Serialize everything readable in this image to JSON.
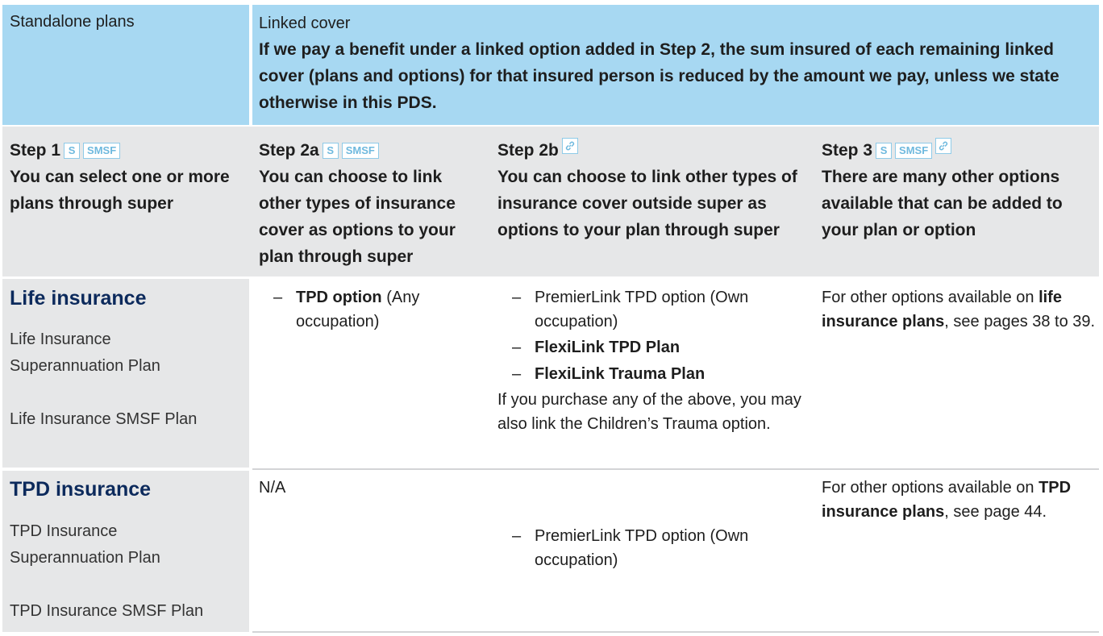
{
  "header": {
    "standalone_label": "Standalone plans",
    "linked_label": "Linked cover",
    "linked_note": "If we pay a benefit under a linked option added in Step 2, the sum insured of each remaining linked cover (plans and options) for that insured person is reduced by the amount we pay, unless we state otherwise in this PDS."
  },
  "badges": {
    "s": "S",
    "smsf": "SMSF"
  },
  "steps": [
    {
      "title": "Step 1",
      "desc": "You can select one or more plans through super"
    },
    {
      "title": "Step 2a",
      "desc": "You can choose to link other types of insurance cover as options to your plan through super"
    },
    {
      "title": "Step 2b",
      "desc": "You can choose to link other types of insurance cover outside super as options to your plan through super"
    },
    {
      "title": "Step 3",
      "desc": "There are many other options available that can be added to your plan or option"
    }
  ],
  "rows": [
    {
      "title": "Life insurance",
      "plan1": "Life Insurance Superannuation Plan",
      "plan2": "Life Insurance SMSF Plan",
      "step2a": {
        "dash": "–",
        "bold": "TPD option",
        "rest": " (Any occupation)"
      },
      "step2b": {
        "items": [
          {
            "dash": "–",
            "text": "PremierLink TPD option (Own occupation)"
          },
          {
            "dash": "–",
            "text": "FlexiLink TPD Plan"
          },
          {
            "dash": "–",
            "text": "FlexiLink Trauma Plan"
          }
        ],
        "note": "If you purchase any of the above, you may also link the Children’s Trauma option."
      },
      "step3": {
        "pre": "For other options available on ",
        "bold": "life insurance plans",
        "post": ", see pages 38 to 39."
      }
    },
    {
      "title": "TPD insurance",
      "plan1": "TPD Insurance Superannuation Plan",
      "plan2": "TPD Insurance SMSF Plan",
      "step2a": {
        "text": "N/A"
      },
      "step2b": {
        "items": [
          {
            "dash": "–",
            "text": "PremierLink TPD option (Own occupation)"
          }
        ]
      },
      "step3": {
        "pre": "For other options available on ",
        "bold": "TPD insurance plans",
        "post": ", see page 44."
      }
    }
  ],
  "icons": {
    "link": "link-icon"
  },
  "colors": {
    "header_bg": "#a7d8f2",
    "grey_bg": "#e6e7e8",
    "title_navy": "#0c2a5c",
    "badge_blue": "#6fb9de"
  }
}
